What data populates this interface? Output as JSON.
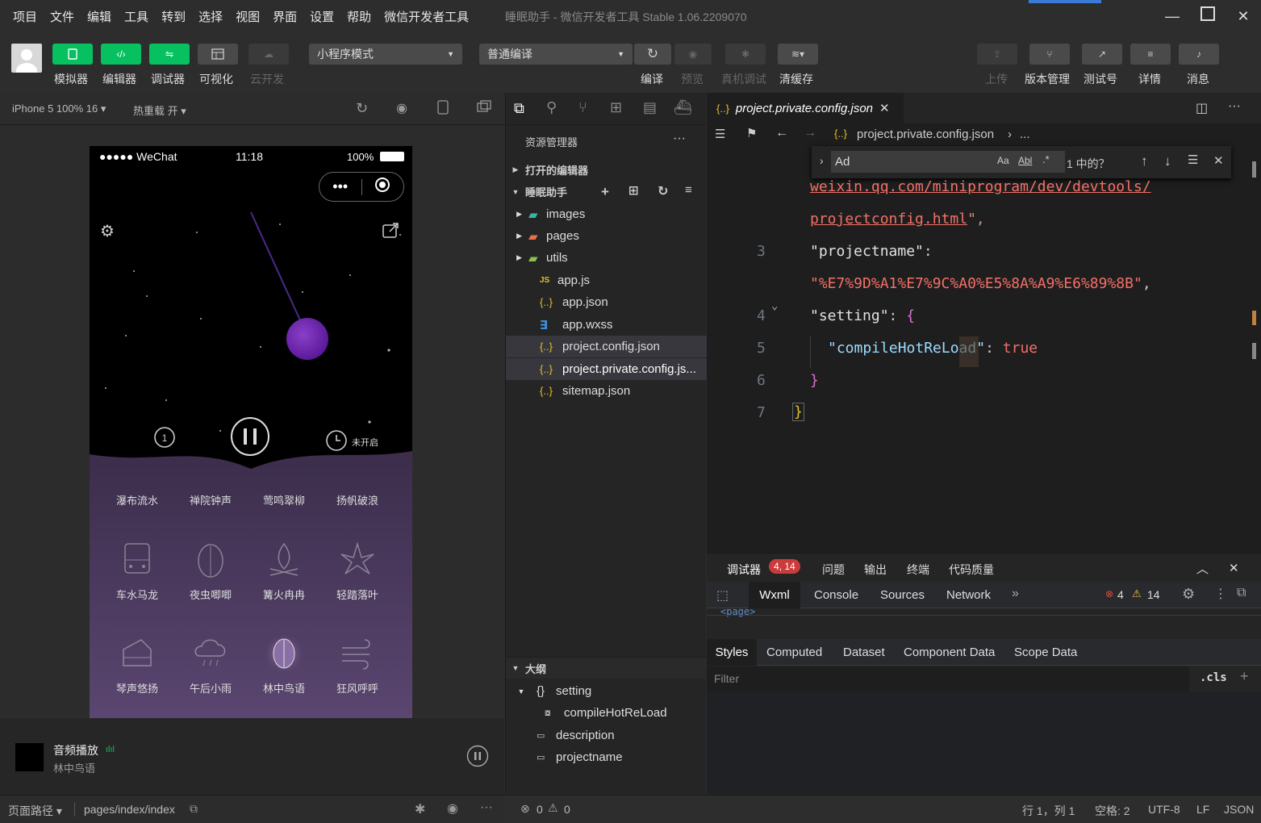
{
  "menu": [
    "项目",
    "文件",
    "编辑",
    "工具",
    "转到",
    "选择",
    "视图",
    "界面",
    "设置",
    "帮助",
    "微信开发者工具"
  ],
  "window_title": "睡眠助手 - 微信开发者工具 Stable 1.06.2209070",
  "toolbar": {
    "simulator": "模拟器",
    "editor": "编辑器",
    "debugger": "调试器",
    "visual": "可视化",
    "cloud": "云开发",
    "mode_select": "小程序模式",
    "compile_select": "普通编译",
    "compile": "编译",
    "preview": "预览",
    "real_debug": "真机调试",
    "clear_cache": "清缓存",
    "upload": "上传",
    "version": "版本管理",
    "test": "测试号",
    "detail": "详情",
    "message": "消息"
  },
  "sim_bar": {
    "device": "iPhone 5 100% 16 ▾",
    "hot_reload": "热重载 开 ▾"
  },
  "phone": {
    "signal": "●●●●● WeChat",
    "time": "11:18",
    "battery": "100%",
    "timer_label": "未开启",
    "categories": [
      "瀑布流水",
      "禅院钟声",
      "莺鸣翠柳",
      "扬帆破浪"
    ],
    "scenes": [
      [
        "车水马龙",
        "夜虫唧唧",
        "篝火冉冉",
        "轻踏落叶"
      ],
      [
        "琴声悠扬",
        "午后小雨",
        "林中鸟语",
        "狂风呼呼"
      ]
    ]
  },
  "audio": {
    "title": "音频播放",
    "subtitle": "林中鸟语"
  },
  "sim_status": {
    "path_label": "页面路径 ▾",
    "path": "pages/index/index"
  },
  "explorer": {
    "title": "资源管理器",
    "open_editors": "打开的编辑器",
    "project": "睡眠助手",
    "files": [
      {
        "name": "images",
        "type": "folder"
      },
      {
        "name": "pages",
        "type": "folder"
      },
      {
        "name": "utils",
        "type": "folder"
      },
      {
        "name": "app.js",
        "type": "js"
      },
      {
        "name": "app.json",
        "type": "json"
      },
      {
        "name": "app.wxss",
        "type": "css"
      },
      {
        "name": "project.config.json",
        "type": "json"
      },
      {
        "name": "project.private.config.js...",
        "type": "json"
      },
      {
        "name": "sitemap.json",
        "type": "json"
      }
    ],
    "outline": "大纲",
    "outline_items": [
      "setting",
      "compileHotReLoad",
      "description",
      "projectname"
    ]
  },
  "editor": {
    "tab": "project.private.config.json",
    "breadcrumb": "project.private.config.json",
    "breadcrumb_more": "...",
    "find_value": "Ad",
    "find_result": "1 中的？",
    "line_numbers": [
      "3",
      "4",
      "5",
      "6",
      "7"
    ],
    "line1": "weixin.qq.com/miniprogram/dev/devtools/",
    "line2": "projectconfig.html",
    "key_projectname": "\"projectname\"",
    "val_projectname": "\"%E7%9D%A1%E7%9C%A0%E5%8A%A9%E6%89%8B\"",
    "key_setting": "\"setting\"",
    "key_compile": "\"compileHotReLoad\"",
    "val_true": "true"
  },
  "debugger": {
    "tabs": [
      "调试器",
      "问题",
      "输出",
      "终端",
      "代码质量"
    ],
    "badge": "4, 14",
    "subtabs": [
      "Wxml",
      "Console",
      "Sources",
      "Network"
    ],
    "errors": "4",
    "warnings": "14",
    "page_tag": "<page>",
    "style_tabs": [
      "Styles",
      "Computed",
      "Dataset",
      "Component Data",
      "Scope Data"
    ],
    "filter_placeholder": "Filter",
    "cls": ".cls"
  },
  "statusbar": {
    "errors": "0",
    "warnings": "0",
    "position": "行 1，列 1",
    "spaces": "空格: 2",
    "encoding": "UTF-8",
    "eol": "LF",
    "lang": "JSON"
  },
  "colors": {
    "green": "#07c160",
    "string": "#f47067",
    "key": "#ce9178",
    "bool": "#f47067",
    "phone_purple": "#4b3a5c"
  }
}
